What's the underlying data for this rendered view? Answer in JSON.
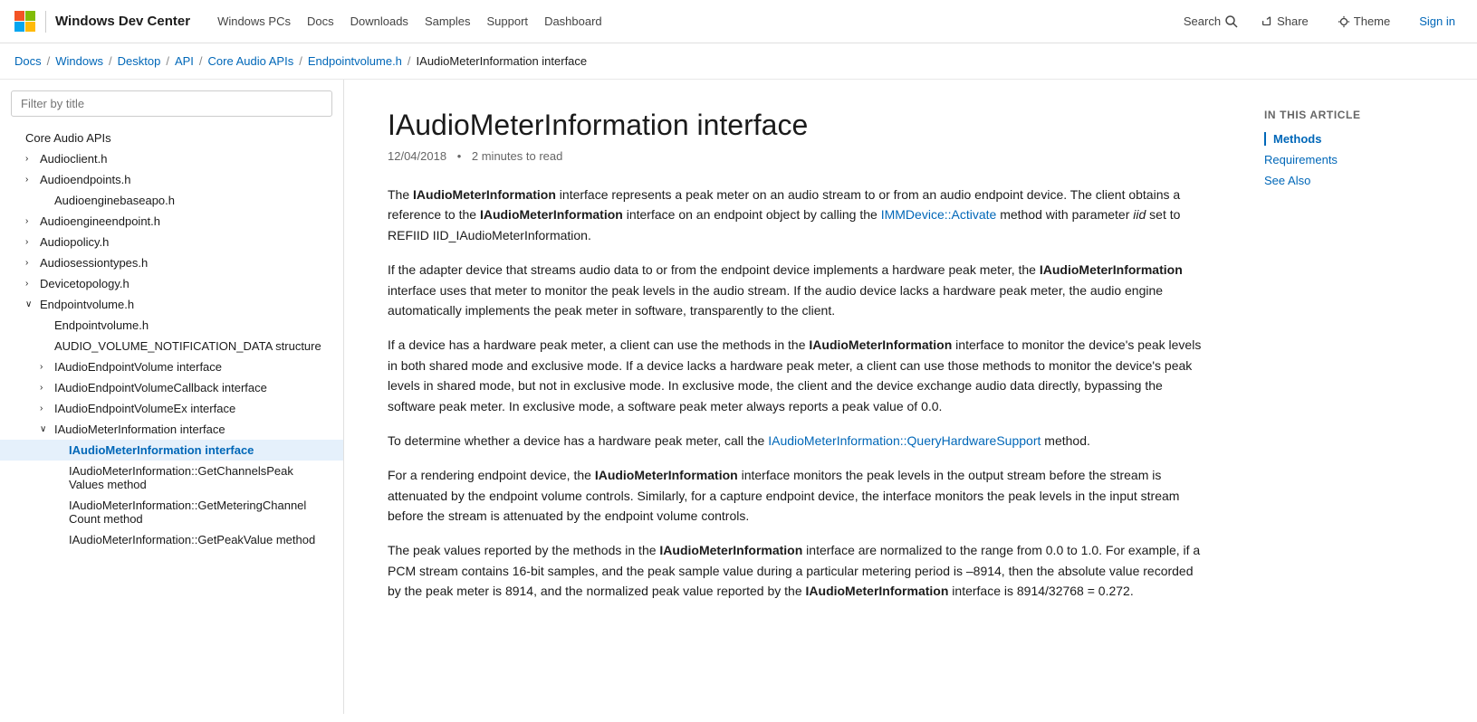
{
  "topnav": {
    "brand": "Windows Dev Center",
    "links": [
      {
        "label": "Windows PCs",
        "href": "#"
      },
      {
        "label": "Docs",
        "href": "#"
      },
      {
        "label": "Downloads",
        "href": "#"
      },
      {
        "label": "Samples",
        "href": "#"
      },
      {
        "label": "Support",
        "href": "#"
      },
      {
        "label": "Dashboard",
        "href": "#"
      }
    ],
    "search_label": "Search",
    "share_label": "Share",
    "theme_label": "Theme",
    "signin_label": "Sign in"
  },
  "breadcrumb": {
    "items": [
      {
        "label": "Docs",
        "href": "#"
      },
      {
        "label": "Windows",
        "href": "#"
      },
      {
        "label": "Desktop",
        "href": "#"
      },
      {
        "label": "API",
        "href": "#"
      },
      {
        "label": "Core Audio APIs",
        "href": "#"
      },
      {
        "label": "Endpointvolume.h",
        "href": "#"
      }
    ],
    "current": "IAudioMeterInformation interface"
  },
  "sidebar": {
    "filter_placeholder": "Filter by title",
    "items": [
      {
        "id": "core-audio-apis",
        "label": "Core Audio APIs",
        "level": 0,
        "chevron": "",
        "expanded": false
      },
      {
        "id": "audioclient-h",
        "label": "Audioclient.h",
        "level": 1,
        "chevron": "›",
        "expanded": false
      },
      {
        "id": "audioendpoints-h",
        "label": "Audioendpoints.h",
        "level": 1,
        "chevron": "›",
        "expanded": false
      },
      {
        "id": "audioenginebaseapo-h",
        "label": "Audioenginebaseapo.h",
        "level": 2,
        "chevron": "",
        "expanded": false
      },
      {
        "id": "audioengineendpoint-h",
        "label": "Audioengineendpoint.h",
        "level": 1,
        "chevron": "›",
        "expanded": false
      },
      {
        "id": "audiopolicy-h",
        "label": "Audiopolicy.h",
        "level": 1,
        "chevron": "›",
        "expanded": false
      },
      {
        "id": "audiosessiontypes-h",
        "label": "Audiosessiontypes.h",
        "level": 1,
        "chevron": "›",
        "expanded": false
      },
      {
        "id": "devicetopology-h",
        "label": "Devicetopology.h",
        "level": 1,
        "chevron": "›",
        "expanded": false
      },
      {
        "id": "endpointvolume-h",
        "label": "Endpointvolume.h",
        "level": 1,
        "chevron": "∨",
        "expanded": true
      },
      {
        "id": "endpointvolume-h-sub",
        "label": "Endpointvolume.h",
        "level": 2,
        "chevron": "",
        "expanded": false
      },
      {
        "id": "audio-volume-notification",
        "label": "AUDIO_VOLUME_NOTIFICATION_DATA structure",
        "level": 2,
        "chevron": "",
        "expanded": false
      },
      {
        "id": "iaudioendpointvolume",
        "label": "IAudioEndpointVolume interface",
        "level": 2,
        "chevron": "›",
        "expanded": false
      },
      {
        "id": "iaudioendpointvolumecallback",
        "label": "IAudioEndpointVolumeCallback interface",
        "level": 2,
        "chevron": "›",
        "expanded": false
      },
      {
        "id": "iaudioendpointvolumeex",
        "label": "IAudioEndpointVolumeEx interface",
        "level": 2,
        "chevron": "›",
        "expanded": false
      },
      {
        "id": "iaudiometerinformation-group",
        "label": "IAudioMeterInformation interface",
        "level": 2,
        "chevron": "∨",
        "expanded": true
      },
      {
        "id": "iaudiometerinformation-interface",
        "label": "IAudioMeterInformation interface",
        "level": 3,
        "chevron": "",
        "expanded": false,
        "active": true
      },
      {
        "id": "getchannelspeakvalues",
        "label": "IAudioMeterInformation::GetChannelsPeak\nValues method",
        "level": 3,
        "chevron": "",
        "expanded": false
      },
      {
        "id": "getmeteringchannelcount",
        "label": "IAudioMeterInformation::GetMeteringChannel\nCount method",
        "level": 3,
        "chevron": "",
        "expanded": false
      },
      {
        "id": "getpeakvalue",
        "label": "IAudioMeterInformation::GetPeakValue method",
        "level": 3,
        "chevron": "",
        "expanded": false
      }
    ]
  },
  "article": {
    "title": "IAudioMeterInformation interface",
    "date": "12/04/2018",
    "read_time": "2 minutes to read",
    "body": [
      {
        "type": "paragraph",
        "parts": [
          {
            "text": "The ",
            "bold": false
          },
          {
            "text": "IAudioMeterInformation",
            "bold": true
          },
          {
            "text": " interface represents a peak meter on an audio stream to or from an audio endpoint device. The client obtains a reference to the ",
            "bold": false
          },
          {
            "text": "IAudioMeterInformation",
            "bold": true
          },
          {
            "text": " interface on an endpoint object by calling the ",
            "bold": false
          },
          {
            "text": "IMMDevice::Activate",
            "bold": false,
            "link": "#"
          },
          {
            "text": " method with parameter ",
            "bold": false
          },
          {
            "text": "iid",
            "bold": false,
            "italic": true
          },
          {
            "text": " set to REFIID IID_IAudioMeterInformation.",
            "bold": false
          }
        ]
      },
      {
        "type": "paragraph",
        "parts": [
          {
            "text": "If the adapter device that streams audio data to or from the endpoint device implements a hardware peak meter, the ",
            "bold": false
          },
          {
            "text": "IAudioMeterInformation",
            "bold": true
          },
          {
            "text": " interface uses that meter to monitor the peak levels in the audio stream. If the audio device lacks a hardware peak meter, the audio engine automatically implements the peak meter in software, transparently to the client.",
            "bold": false
          }
        ]
      },
      {
        "type": "paragraph",
        "parts": [
          {
            "text": "If a device has a hardware peak meter, a client can use the methods in the ",
            "bold": false
          },
          {
            "text": "IAudioMeterInformation",
            "bold": true
          },
          {
            "text": " interface to monitor the device's peak levels in both shared mode and exclusive mode. If a device lacks a hardware peak meter, a client can use those methods to monitor the device's peak levels in shared mode, but not in exclusive mode. In exclusive mode, the client and the device exchange audio data directly, bypassing the software peak meter. In exclusive mode, a software peak meter always reports a peak value of 0.0.",
            "bold": false
          }
        ]
      },
      {
        "type": "paragraph",
        "parts": [
          {
            "text": "To determine whether a device has a hardware peak meter, call the ",
            "bold": false
          },
          {
            "text": "IAudioMeterInformation::QueryHardwareSupport",
            "bold": false,
            "link": "#"
          },
          {
            "text": " method.",
            "bold": false
          }
        ]
      },
      {
        "type": "paragraph",
        "parts": [
          {
            "text": "For a rendering endpoint device, the ",
            "bold": false
          },
          {
            "text": "IAudioMeterInformation",
            "bold": true
          },
          {
            "text": " interface monitors the peak levels in the output stream before the stream is attenuated by the endpoint volume controls. Similarly, for a capture endpoint device, the interface monitors the peak levels in the input stream before the stream is attenuated by the endpoint volume controls.",
            "bold": false
          }
        ]
      },
      {
        "type": "paragraph",
        "parts": [
          {
            "text": "The peak values reported by the methods in the ",
            "bold": false
          },
          {
            "text": "IAudioMeterInformation",
            "bold": true
          },
          {
            "text": " interface are normalized to the range from 0.0 to 1.0. For example, if a PCM stream contains 16-bit samples, and the peak sample value during a particular metering period is –8914, then the absolute value recorded by the peak meter is 8914, and the normalized peak value reported by the ",
            "bold": false
          },
          {
            "text": "IAudioMeterInformation",
            "bold": true
          },
          {
            "text": " interface is 8914/32768 = 0.272.",
            "bold": false
          }
        ]
      }
    ]
  },
  "toc": {
    "title": "In this article",
    "items": [
      {
        "label": "Methods",
        "href": "#",
        "active": true
      },
      {
        "label": "Requirements",
        "href": "#",
        "active": false
      },
      {
        "label": "See Also",
        "href": "#",
        "active": false
      }
    ]
  }
}
